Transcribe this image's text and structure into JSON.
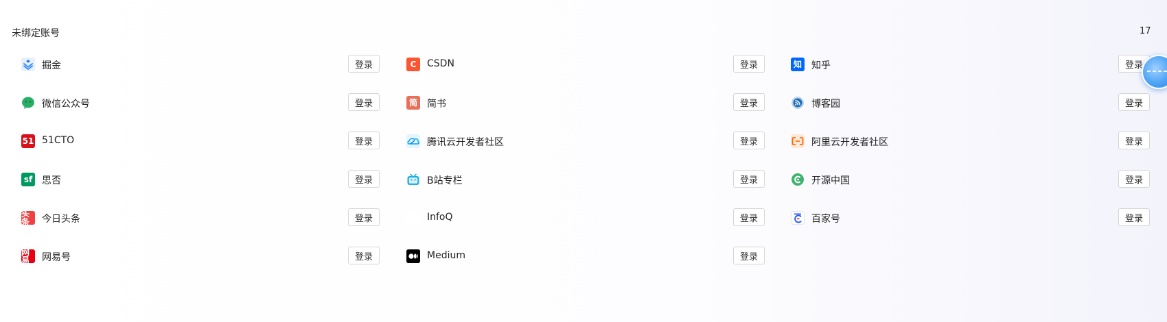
{
  "section": {
    "title": "未绑定账号",
    "count": "17"
  },
  "login_label": "登录",
  "rows": [
    [
      {
        "name": "掘金",
        "icon": "juejin-icon"
      },
      {
        "name": "CSDN",
        "icon": "csdn-icon",
        "glyph": "C"
      },
      {
        "name": "知乎",
        "icon": "zhihu-icon",
        "glyph": "知"
      }
    ],
    [
      {
        "name": "微信公众号",
        "icon": "wechat-icon"
      },
      {
        "name": "简书",
        "icon": "jianshu-icon",
        "glyph": "简"
      },
      {
        "name": "博客园",
        "icon": "cnblogs-icon"
      }
    ],
    [
      {
        "name": "51CTO",
        "icon": "51cto-icon",
        "glyph": "51"
      },
      {
        "name": "腾讯云开发者社区",
        "icon": "tencent-cloud-icon"
      },
      {
        "name": "阿里云开发者社区",
        "icon": "aliyun-icon"
      }
    ],
    [
      {
        "name": "思否",
        "icon": "segmentfault-icon",
        "glyph": "sf"
      },
      {
        "name": "B站专栏",
        "icon": "bilibili-icon"
      },
      {
        "name": "开源中国",
        "icon": "oschina-icon"
      }
    ],
    [
      {
        "name": "今日头条",
        "icon": "toutiao-icon",
        "glyph": "头条"
      },
      {
        "name": "InfoQ",
        "icon": "infoq-icon",
        "glyph": "InfoQ"
      },
      {
        "name": "百家号",
        "icon": "baijiahao-icon"
      }
    ],
    [
      {
        "name": "网易号",
        "icon": "netease-icon",
        "glyph": "网易"
      },
      {
        "name": "Medium",
        "icon": "medium-icon"
      }
    ]
  ],
  "colors": {
    "juejin": "#1e80ff",
    "csdn": "#fc5531",
    "zhihu": "#0066ff",
    "wechat": "#07c160",
    "jianshu": "#ea6f5a",
    "51cto": "#d9101a",
    "segmentfault": "#009a61",
    "toutiao": "#f04142",
    "netease": "#e60012"
  }
}
